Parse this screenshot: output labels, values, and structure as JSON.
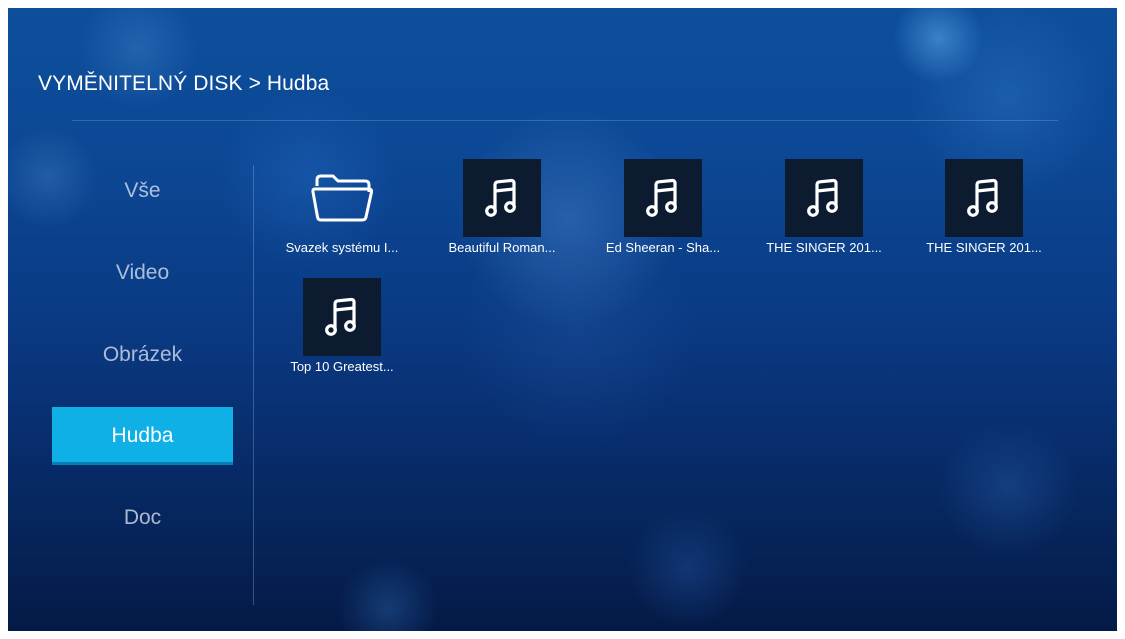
{
  "header": {
    "breadcrumb": "VYMĚNITELNÝ DISK > Hudba"
  },
  "sidebar": {
    "items": [
      {
        "label": "Vše",
        "active": false
      },
      {
        "label": "Video",
        "active": false
      },
      {
        "label": "Obrázek",
        "active": false
      },
      {
        "label": "Hudba",
        "active": true
      },
      {
        "label": "Doc",
        "active": false
      }
    ]
  },
  "files": [
    {
      "label": "Svazek systému I...",
      "icon": "folder-icon"
    },
    {
      "label": "Beautiful Roman...",
      "icon": "music-note-icon"
    },
    {
      "label": "Ed Sheeran - Sha...",
      "icon": "music-note-icon"
    },
    {
      "label": "THE SINGER 201...",
      "icon": "music-note-icon"
    },
    {
      "label": "THE SINGER 201...",
      "icon": "music-note-icon"
    },
    {
      "label": "Top 10 Greatest...",
      "icon": "music-note-icon"
    }
  ],
  "colors": {
    "accent": "#0fb0e6",
    "background": "#0c4794",
    "thumb": "#0c1b30"
  }
}
